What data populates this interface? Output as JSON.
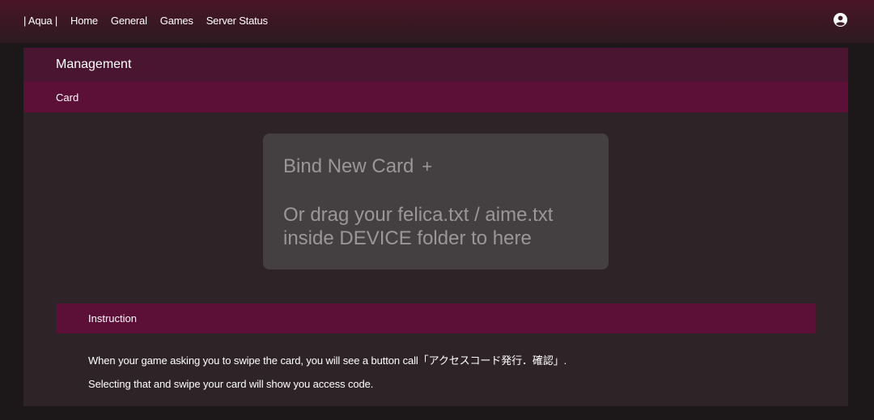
{
  "nav": {
    "brand": "| Aqua |",
    "links": [
      "Home",
      "General",
      "Games",
      "Server Status"
    ],
    "user_icon": "user-circle-icon"
  },
  "panel": {
    "title": "Management",
    "tab": "Card"
  },
  "dropzone": {
    "bind_label": "Bind New Card",
    "plus": "+",
    "drag_text": "Or drag your felica.txt / aime.txt inside DEVICE folder to here"
  },
  "instruction": {
    "header": "Instruction",
    "line1": "When your game asking you to swipe the card, you will see a button call「アクセスコード発行．確認」.",
    "line2": "Selecting that and swipe your card will show you access code."
  },
  "colors": {
    "nav_gradient_top": "#4a1526",
    "panel_header": "#4a1530",
    "tab_bar": "#5c1038",
    "panel_bg": "#2e2428",
    "dropzone_bg": "#444041",
    "dropzone_text": "#9b9697"
  }
}
